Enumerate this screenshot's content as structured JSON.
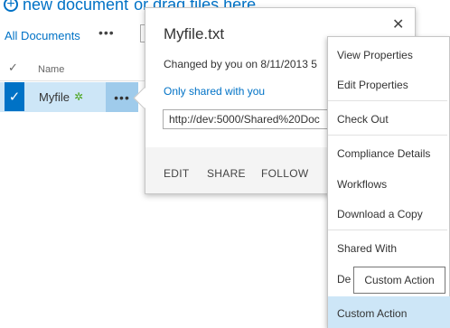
{
  "toolbar": {
    "new_document_label": "new document",
    "drag_text": "or drag files here"
  },
  "view": {
    "current_view": "All Documents",
    "more_label": "•••"
  },
  "list": {
    "column_name": "Name",
    "check_glyph": "✓",
    "rows": [
      {
        "name": "Myfile",
        "new_glyph": "✲",
        "ellipsis": "•••"
      }
    ]
  },
  "callout": {
    "title": "Myfile.txt",
    "close_glyph": "✕",
    "changed_text": "Changed by you on 8/11/2013 5",
    "shared_text": "Only shared with you",
    "url": "http://dev:5000/Shared%20Doc",
    "actions": [
      "EDIT",
      "SHARE",
      "FOLLOW"
    ]
  },
  "menu": {
    "items": [
      "View Properties",
      "Edit Properties",
      "Check Out",
      "Compliance Details",
      "Workflows",
      "Download a Copy",
      "Shared With",
      "De",
      "Custom Action"
    ],
    "tooltip": "Custom Action"
  },
  "colors": {
    "accent": "#0072c6",
    "selected_row": "#cde6f7",
    "new_badge": "#4ba41d"
  }
}
